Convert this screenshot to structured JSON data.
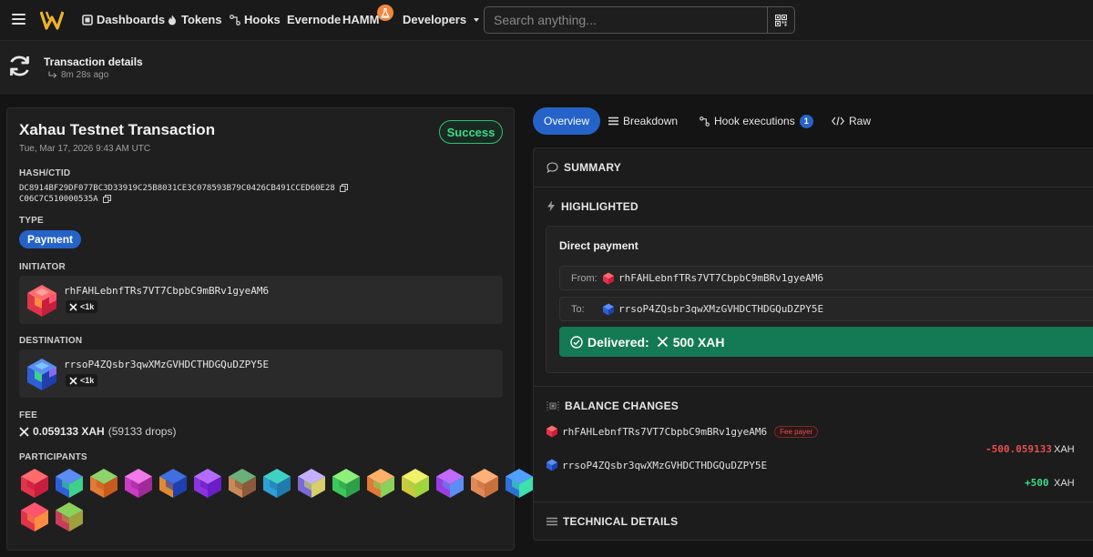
{
  "nav": {
    "items": [
      {
        "label": "Dashboards",
        "icon": "dashboard-icon"
      },
      {
        "label": "Tokens",
        "icon": "flame-icon"
      },
      {
        "label": "Hooks",
        "icon": "hook-icon"
      },
      {
        "label": "Evernode"
      },
      {
        "label": "HAMM",
        "badge_icon": "flask-icon"
      },
      {
        "label": "Developers",
        "dropdown": true
      }
    ],
    "search_placeholder": "Search anything..."
  },
  "header": {
    "title": "Transaction details",
    "time_ago": "8m 28s ago"
  },
  "transaction": {
    "title": "Xahau Testnet Transaction",
    "date": "Tue, Mar 17, 2026 9:43 AM UTC",
    "status": "Success",
    "hash_label": "HASH/CTID",
    "hash": "DC8914BF29DF077BC3D33919C25B8031CE3C078593B79C0426CB491CCED60E28",
    "ctid": "C06C7C510000535A",
    "type_label": "TYPE",
    "type": "Payment",
    "initiator_label": "INITIATOR",
    "initiator": {
      "address": "rhFAHLebnfTRs7VT7CbpbC9mBRv1gyeAM6",
      "balance": "<1k"
    },
    "destination_label": "DESTINATION",
    "destination": {
      "address": "rrsoP4ZQsbr3qwXMzGVHDCTHDGQuDZPY5E",
      "balance": "<1k"
    },
    "fee_label": "FEE",
    "fee": "0.059133 XAH",
    "fee_drops": "(59133 drops)",
    "participants_label": "PARTICIPANTS",
    "participants_count": 17
  },
  "tabs": [
    {
      "label": "Overview",
      "active": true
    },
    {
      "label": "Breakdown"
    },
    {
      "label": "Hook executions",
      "badge": "1"
    },
    {
      "label": "Raw"
    }
  ],
  "panel": {
    "summary": "SUMMARY",
    "highlighted": "HIGHLIGHTED",
    "direct_payment": {
      "title": "Direct payment",
      "from_label": "From:",
      "from": "rhFAHLebnfTRs7VT7CbpbC9mBRv1gyeAM6",
      "to_label": "To:",
      "to": "rrsoP4ZQsbr3qwXMzGVHDCTHDGQuDZPY5E",
      "delivered_label": "Delivered:",
      "delivered": "500 XAH"
    },
    "balance_changes": "BALANCE CHANGES",
    "changes": [
      {
        "address": "rhFAHLebnfTRs7VT7CbpbC9mBRv1gyeAM6",
        "tag": "Fee payer",
        "amount": "-500.059133",
        "currency": "XAH"
      },
      {
        "address": "rrsoP4ZQsbr3qwXMzGVHDCTHDGQuDZPY5E",
        "amount": "+500",
        "currency": "XAH"
      }
    ],
    "technical": "TECHNICAL DETAILS"
  },
  "colors": {
    "accent": "#2563c9",
    "success": "#3ddc84",
    "delivered_bg": "#137a55",
    "negative": "#e55050",
    "positive": "#3ddc84"
  }
}
